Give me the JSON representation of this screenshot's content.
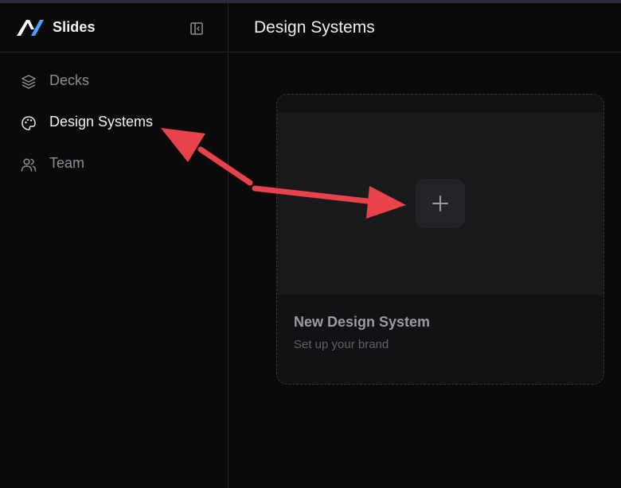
{
  "app": {
    "title": "Slides"
  },
  "sidebar": {
    "items": [
      {
        "label": "Decks",
        "icon": "layers-icon",
        "active": false
      },
      {
        "label": "Design Systems",
        "icon": "palette-icon",
        "active": true
      },
      {
        "label": "Team",
        "icon": "users-icon",
        "active": false
      }
    ]
  },
  "main": {
    "title": "Design Systems",
    "card": {
      "title": "New Design System",
      "subtitle": "Set up your brand",
      "action_icon": "plus-icon"
    }
  },
  "colors": {
    "background": "#0a0a0b",
    "accent_logo": "#4aa3ff",
    "annotation_arrow": "#e8424a"
  }
}
